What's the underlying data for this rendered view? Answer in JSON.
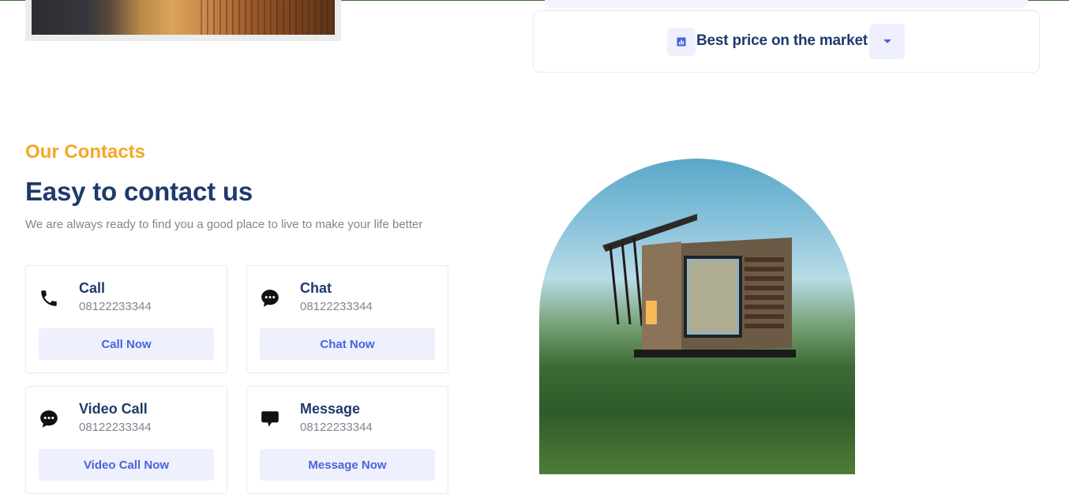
{
  "accordion": {
    "title": "Best price on the market"
  },
  "contacts": {
    "eyebrow": "Our Contacts",
    "heading": "Easy to contact us",
    "subtext": "We are always ready to find you a good place to live to make your life better",
    "cards": [
      {
        "title": "Call",
        "number": "08122233344",
        "button": "Call Now",
        "icon": "phone-icon"
      },
      {
        "title": "Chat",
        "number": "08122233344",
        "button": "Chat Now",
        "icon": "chat-icon"
      },
      {
        "title": "Video Call",
        "number": "08122233344",
        "button": "Video Call Now",
        "icon": "video-chat-icon"
      },
      {
        "title": "Message",
        "number": "08122233344",
        "button": "Message Now",
        "icon": "message-icon"
      }
    ]
  },
  "colors": {
    "accent": "#f4a823",
    "heading": "#1f3a6b",
    "button_bg": "#eef0fd",
    "button_text": "#4a63d9"
  }
}
